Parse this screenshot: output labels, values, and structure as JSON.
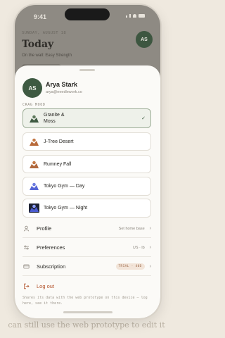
{
  "background_caption": "can still use the web prototype to edit it",
  "status_bar": {
    "time": "9:41"
  },
  "background_app": {
    "greeting": "SUNDAY, AUGUST 18",
    "title": "Today",
    "subtitle": "On the wall: Easy Strength",
    "avatar_initials": "AS"
  },
  "account": {
    "initials": "AS",
    "name": "Arya Stark",
    "email": "arya@needlework.co"
  },
  "crag_mood": {
    "label": "CRAG MOOD",
    "options": [
      {
        "label": "Granite & Moss",
        "icon": "granite-moss-icon",
        "selected": true
      },
      {
        "label": "J-Tree Desert",
        "icon": "desert-rock-icon",
        "selected": false
      },
      {
        "label": "Rumney Fall",
        "icon": "fall-rock-icon",
        "selected": false
      },
      {
        "label": "Tokyo Gym — Day",
        "icon": "gym-day-icon",
        "selected": false
      },
      {
        "label": "Tokyo Gym — Night",
        "icon": "gym-night-icon",
        "selected": false
      }
    ]
  },
  "menu": {
    "profile": {
      "label": "Profile",
      "value": "Set home base"
    },
    "preferences": {
      "label": "Preferences",
      "value": "US · lb"
    },
    "subscription": {
      "label": "Subscription",
      "badge": "TRIAL · 40D"
    },
    "logout": {
      "label": "Log out"
    }
  },
  "footnote": "Shares its data with the web prototype on this device — log here, see it there.",
  "colors": {
    "accent": "#3e5a42",
    "logout": "#b2522a",
    "badge_bg": "#f2e4d8",
    "sheet_bg": "#fbfaf7"
  }
}
